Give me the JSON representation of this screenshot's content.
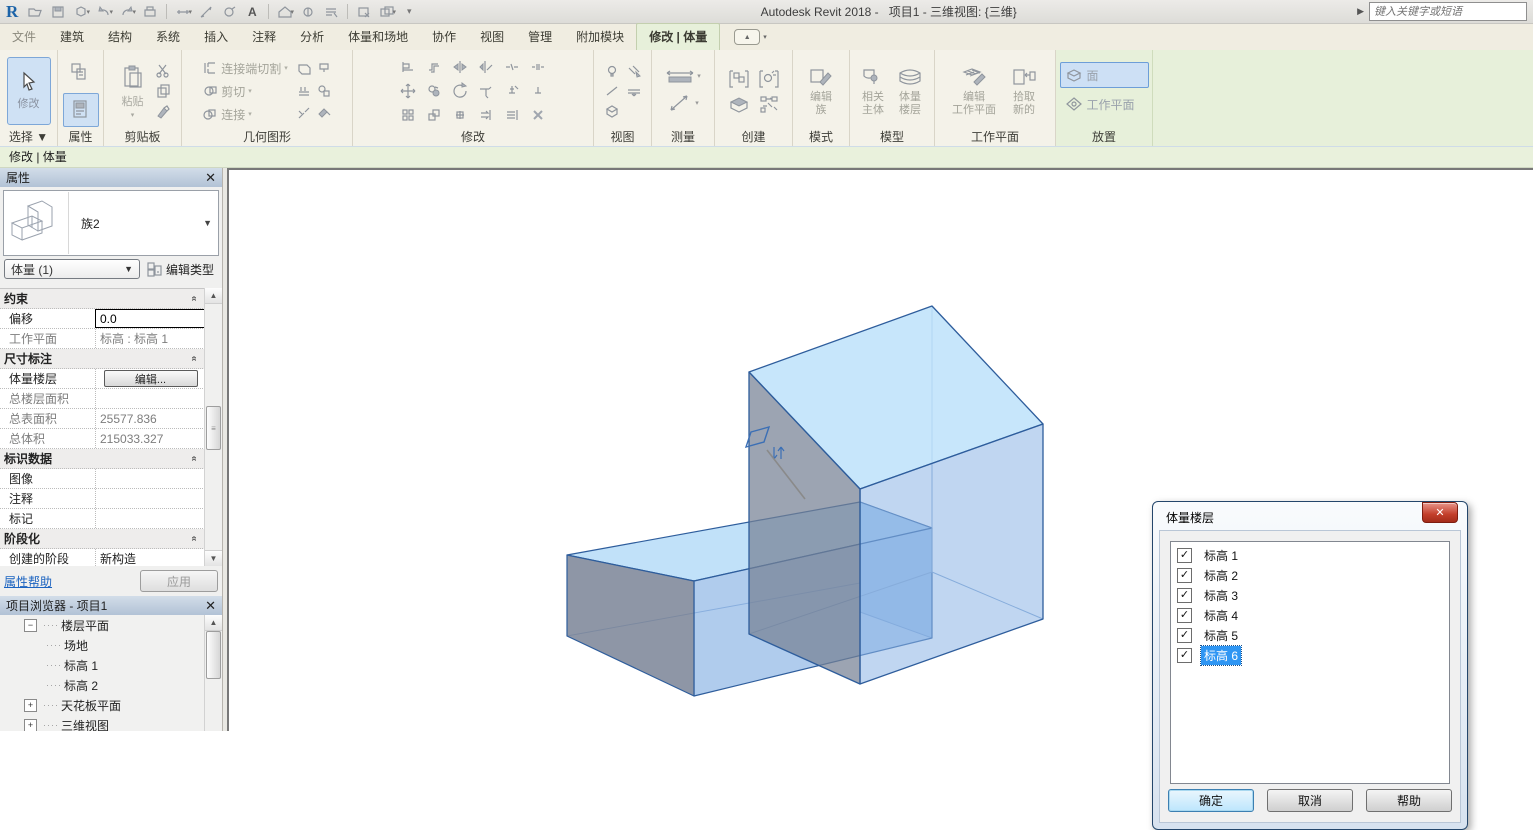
{
  "titlebar": {
    "app": "Autodesk Revit 2018 -",
    "doc": "项目1 - 三维视图: {三维}",
    "search_placeholder": "键入关键字或短语"
  },
  "tabs": {
    "items": [
      "文件",
      "建筑",
      "结构",
      "系统",
      "插入",
      "注释",
      "分析",
      "体量和场地",
      "协作",
      "视图",
      "管理",
      "附加模块"
    ],
    "active": "修改 | 体量"
  },
  "ribbon": {
    "select": {
      "panel": "选择 ▼",
      "modify": "修改"
    },
    "properties_panel": "属性",
    "clipboard": {
      "panel": "剪贴板",
      "paste": "粘贴"
    },
    "geometry": {
      "panel": "几何图形",
      "join_cut": "连接端切割",
      "cut": "剪切",
      "join": "连接"
    },
    "modify_panel": "修改",
    "view_panel": "视图",
    "measure_panel": "测量",
    "create_panel": "创建",
    "mode": {
      "panel": "模式",
      "l1": "编辑",
      "l2": "族"
    },
    "model": {
      "panel": "模型",
      "a1": "相关",
      "a2": "主体",
      "b1": "体量",
      "b2": "楼层"
    },
    "workplane": {
      "panel": "工作平面",
      "a1": "编辑",
      "a2": "工作平面",
      "b1": "拾取",
      "b2": "新的"
    },
    "place": {
      "panel": "放置",
      "face": "面",
      "workplane": "工作平面"
    }
  },
  "modebar": "修改 | 体量",
  "props": {
    "title": "属性",
    "type_name": "族2",
    "instance": "体量 (1)",
    "edit_type": "编辑类型",
    "groups": [
      {
        "label": "约束",
        "rows": [
          {
            "label": "偏移",
            "value": "0.0"
          },
          {
            "label": "工作平面",
            "value": "标高 : 标高 1"
          }
        ]
      },
      {
        "label": "尺寸标注",
        "rows": [
          {
            "label": "体量楼层",
            "value": "编辑..."
          },
          {
            "label": "总楼层面积",
            "value": ""
          },
          {
            "label": "总表面积",
            "value": "25577.836"
          },
          {
            "label": "总体积",
            "value": "215033.327"
          }
        ]
      },
      {
        "label": "标识数据",
        "rows": [
          {
            "label": "图像",
            "value": ""
          },
          {
            "label": "注释",
            "value": ""
          },
          {
            "label": "标记",
            "value": ""
          }
        ]
      },
      {
        "label": "阶段化",
        "rows": [
          {
            "label": "创建的阶段",
            "value": "新构造"
          }
        ]
      }
    ],
    "help": "属性帮助",
    "apply": "应用"
  },
  "browser": {
    "title": "项目浏览器 - 项目1",
    "items": [
      "楼层平面",
      "场地",
      "标高 1",
      "标高 2",
      "天花板平面",
      "三维视图"
    ]
  },
  "dialog": {
    "title": "体量楼层",
    "items": [
      "标高 1",
      "标高 2",
      "标高 3",
      "标高 4",
      "标高 5",
      "标高 6"
    ],
    "ok": "确定",
    "cancel": "取消",
    "help": "帮助"
  }
}
